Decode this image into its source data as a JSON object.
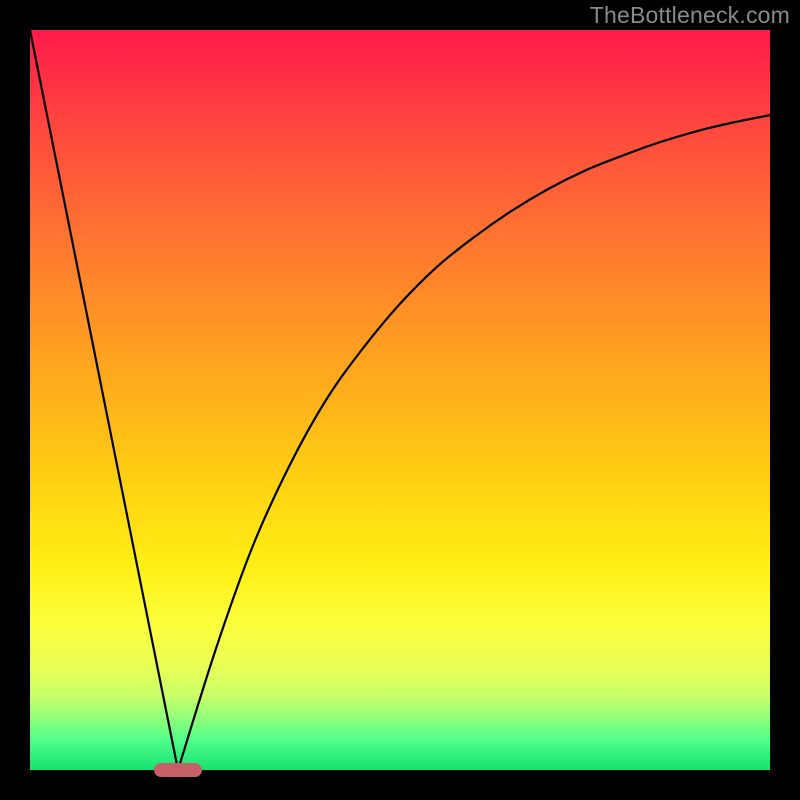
{
  "watermark": "TheBottleneck.com",
  "chart_data": {
    "type": "line",
    "title": "",
    "xlabel": "",
    "ylabel": "",
    "xlim": [
      0,
      100
    ],
    "ylim": [
      0,
      100
    ],
    "grid": false,
    "legend": false,
    "series": [
      {
        "name": "left-segment",
        "x": [
          0,
          20
        ],
        "y": [
          100,
          0
        ]
      },
      {
        "name": "right-curve",
        "x": [
          20,
          25,
          30,
          35,
          40,
          45,
          50,
          55,
          60,
          65,
          70,
          75,
          80,
          85,
          90,
          95,
          100
        ],
        "y": [
          0,
          16,
          30,
          41,
          50,
          57,
          63,
          68,
          72,
          75.5,
          78.5,
          81,
          83,
          84.8,
          86.3,
          87.5,
          88.5
        ]
      }
    ],
    "marker": {
      "x": 20,
      "y": 0,
      "shape": "pill",
      "color": "#c76067"
    },
    "background_gradient": {
      "direction": "vertical",
      "stops": [
        {
          "pos": 0,
          "color": "#ff1a4b"
        },
        {
          "pos": 0.5,
          "color": "#ffb518"
        },
        {
          "pos": 0.8,
          "color": "#fcff3a"
        },
        {
          "pos": 1,
          "color": "#16e06f"
        }
      ]
    }
  },
  "dims": {
    "outer": 800,
    "inner": 740,
    "inset": 30
  }
}
